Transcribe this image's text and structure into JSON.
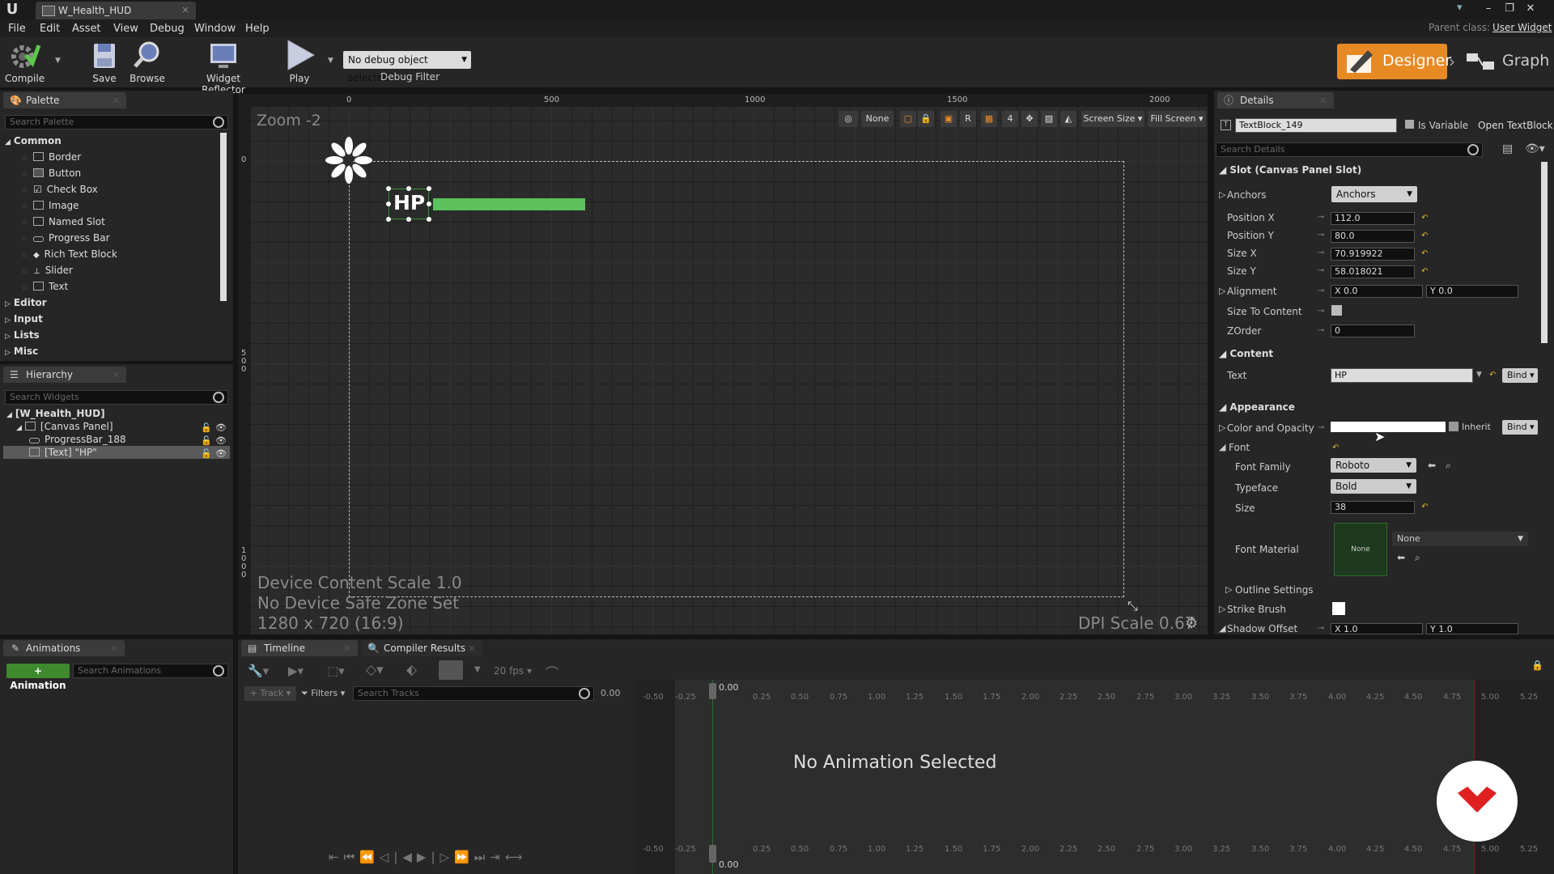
{
  "window": {
    "tab_title": "W_Health_HUD",
    "parent_class_label": "Parent class:",
    "parent_class_value": "User Widget"
  },
  "menu": [
    "File",
    "Edit",
    "Asset",
    "View",
    "Debug",
    "Window",
    "Help"
  ],
  "toolbar": {
    "compile": "Compile",
    "save": "Save",
    "browse": "Browse",
    "widget_reflector": "Widget Reflector",
    "play": "Play",
    "debug_select": "No debug object selected",
    "debug_filter": "Debug Filter",
    "designer": "Designer",
    "graph": "Graph"
  },
  "palette": {
    "tab": "Palette",
    "search_placeholder": "Search Palette",
    "common": "Common",
    "items": [
      "Border",
      "Button",
      "Check Box",
      "Image",
      "Named Slot",
      "Progress Bar",
      "Rich Text Block",
      "Slider",
      "Text"
    ],
    "categories": [
      "Editor",
      "Input",
      "Lists",
      "Misc"
    ]
  },
  "hierarchy": {
    "tab": "Hierarchy",
    "search_placeholder": "Search Widgets",
    "root": "[W_Health_HUD]",
    "canvas": "[Canvas Panel]",
    "progress": "ProgressBar_188",
    "text": "[Text] \"HP\""
  },
  "viewport": {
    "zoom": "Zoom -2",
    "ruler_marks": [
      "0",
      "500",
      "1000",
      "1500",
      "2000"
    ],
    "ruler_left": [
      "0",
      "500",
      "1000"
    ],
    "none_label": "None",
    "r_label": "R",
    "grid_num": "4",
    "screen_size": "Screen Size",
    "fill_screen": "Fill Screen",
    "hp_text": "HP",
    "device_scale": "Device Content Scale 1.0",
    "safe_zone": "No Device Safe Zone Set",
    "resolution": "1280 x 720 (16:9)",
    "dpi": "DPI Scale 0.67"
  },
  "details": {
    "tab": "Details",
    "widget_name": "TextBlock_149",
    "is_variable": "Is Variable",
    "open_textblock": "Open TextBlock",
    "search_placeholder": "Search Details",
    "slot_section": "Slot (Canvas Panel Slot)",
    "anchors_label": "Anchors",
    "anchors_value": "Anchors",
    "pos_x_label": "Position X",
    "pos_x": "112.0",
    "pos_y_label": "Position Y",
    "pos_y": "80.0",
    "size_x_label": "Size X",
    "size_x": "70.919922",
    "size_y_label": "Size Y",
    "size_y": "58.018021",
    "alignment_label": "Alignment",
    "align_x": "X  0.0",
    "align_y": "Y  0.0",
    "size_to_content": "Size To Content",
    "zorder_label": "ZOrder",
    "zorder": "0",
    "content_section": "Content",
    "text_label": "Text",
    "text_value": "HP",
    "bind": "Bind",
    "appearance_section": "Appearance",
    "color_label": "Color and Opacity",
    "inherit": "Inherit",
    "font_label": "Font",
    "font_family_label": "Font Family",
    "font_family": "Roboto",
    "typeface_label": "Typeface",
    "typeface": "Bold",
    "size_label": "Size",
    "size": "38",
    "font_material_label": "Font Material",
    "font_material_thumb": "None",
    "font_material_value": "None",
    "outline_label": "Outline Settings",
    "strike_label": "Strike Brush",
    "shadow_label": "Shadow Offset",
    "shadow_x": "X  1.0",
    "shadow_y": "Y  1.0"
  },
  "animations": {
    "tab": "Animations",
    "add_button": "+ Animation",
    "search_placeholder": "Search Animations"
  },
  "timeline": {
    "tab": "Timeline",
    "compiler_tab": "Compiler Results",
    "fps": "20 fps",
    "track": "+ Track",
    "filters": "Filters",
    "search_placeholder": "Search Tracks",
    "time": "0.00",
    "ticks": [
      "-0.50",
      "-0.25",
      "0.25",
      "0.50",
      "0.75",
      "1.00",
      "1.25",
      "1.50",
      "1.75",
      "2.00",
      "2.25",
      "2.50",
      "2.75",
      "3.00",
      "3.25",
      "3.50",
      "3.75",
      "4.00",
      "4.25",
      "4.50",
      "4.75",
      "5.00",
      "5.25"
    ],
    "no_animation": "No Animation Selected"
  },
  "colors": {
    "accent": "#e88a24",
    "progress": "#5cc05c",
    "selection": "#3a8e3a"
  }
}
